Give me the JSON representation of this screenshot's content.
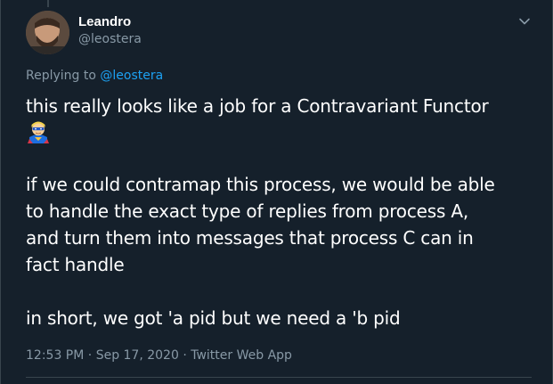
{
  "tweet": {
    "author": {
      "name": "Leandro",
      "handle": "@leostera"
    },
    "replying": {
      "prefix": "Replying to",
      "mention": "@leostera"
    },
    "paragraphs": [
      [
        "this really looks like a job for a Contravariant Functor"
      ],
      [
        "if we could contramap this process, we would be able",
        "to handle the exact type of replies from process A,",
        "and turn them into messages that process C can in",
        "fact handle"
      ],
      [
        "in short, we got 'a pid but we need a 'b pid"
      ]
    ],
    "emoji": "man-superhero-emoji",
    "meta": {
      "time": "12:53 PM",
      "separator": "·",
      "date": "Sep 17, 2020",
      "source": "Twitter Web App"
    },
    "colors": {
      "background": "#15202b",
      "text": "#ffffff",
      "secondary": "#8899a6",
      "accent": "#1da1f2",
      "border": "#38444d"
    },
    "icons": [
      "chevron-down-icon"
    ]
  }
}
